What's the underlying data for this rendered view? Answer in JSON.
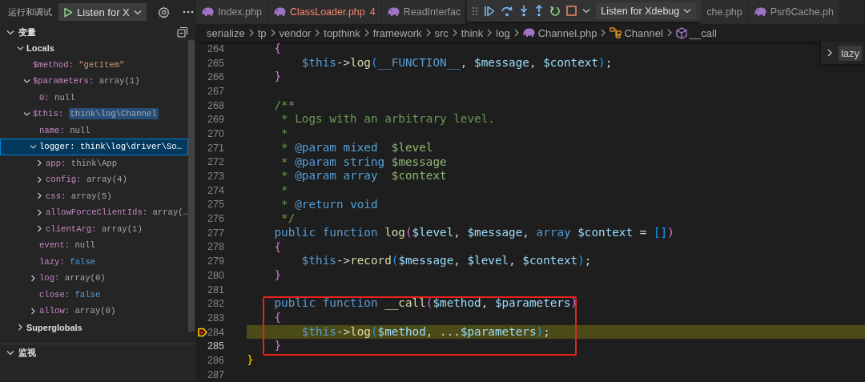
{
  "sidebar": {
    "title": "运行和调试",
    "launch_config": "Listen for X"
  },
  "variables_section": {
    "title": "变量",
    "expanded": true,
    "items": [
      {
        "name": "Locals",
        "kind": "scope",
        "expanded": true,
        "selected": false,
        "children": [
          {
            "name": "$method:",
            "value": "\"getItem\"",
            "kind": "string",
            "selected": false,
            "value_highlighted": false
          },
          {
            "name": "$parameters:",
            "value": "array(1)",
            "kind": "type",
            "expanded": true,
            "selected": false,
            "value_highlighted": false,
            "children": [
              {
                "name": "0:",
                "value": "null",
                "kind": "null",
                "selected": false,
                "value_highlighted": false
              }
            ]
          },
          {
            "name": "$this:",
            "value": "think\\log\\Channel",
            "kind": "type",
            "expanded": true,
            "selected": false,
            "value_highlighted": true,
            "children": [
              {
                "name": "name:",
                "value": "null",
                "kind": "null",
                "selected": false,
                "value_highlighted": false
              },
              {
                "name": "logger:",
                "value": "think\\log\\driver\\So…",
                "kind": "type",
                "expanded": true,
                "selected": true,
                "value_highlighted": false,
                "children": [
                  {
                    "name": "app:",
                    "value": "think\\App",
                    "kind": "type",
                    "expanded": false,
                    "selected": false,
                    "value_highlighted": false
                  },
                  {
                    "name": "config:",
                    "value": "array(4)",
                    "kind": "type",
                    "expanded": false,
                    "selected": false,
                    "value_highlighted": false
                  },
                  {
                    "name": "css:",
                    "value": "array(5)",
                    "kind": "type",
                    "expanded": false,
                    "selected": false,
                    "value_highlighted": false
                  },
                  {
                    "name": "allowForceClientIds:",
                    "value": "array(…",
                    "kind": "type",
                    "expanded": false,
                    "selected": false,
                    "value_highlighted": false
                  },
                  {
                    "name": "clientArg:",
                    "value": "array(1)",
                    "kind": "type",
                    "expanded": false,
                    "selected": false,
                    "value_highlighted": false
                  }
                ]
              },
              {
                "name": "event:",
                "value": "null",
                "kind": "null",
                "selected": false,
                "value_highlighted": false
              },
              {
                "name": "lazy:",
                "value": "false",
                "kind": "bool",
                "selected": false,
                "value_highlighted": false
              },
              {
                "name": "log:",
                "value": "array(0)",
                "kind": "type",
                "expanded": false,
                "selected": false,
                "value_highlighted": false
              },
              {
                "name": "close:",
                "value": "false",
                "kind": "bool",
                "selected": false,
                "value_highlighted": false
              },
              {
                "name": "allow:",
                "value": "array(0)",
                "kind": "type",
                "expanded": false,
                "selected": false,
                "value_highlighted": false
              }
            ]
          }
        ]
      },
      {
        "name": "Superglobals",
        "kind": "scope",
        "expanded": false,
        "selected": false
      }
    ]
  },
  "watch_section": {
    "title": "监视",
    "expanded": true
  },
  "tabs": [
    {
      "label": "Index.php",
      "icon_visible": true,
      "has_errors": false,
      "selected": false
    },
    {
      "label": "ClassLoader.php",
      "problems": "4",
      "icon_visible": true,
      "has_errors": true,
      "selected": false
    },
    {
      "label": "ReadInterfac",
      "icon_visible": true,
      "has_errors": false,
      "selected": false
    },
    {
      "label": "che.php",
      "icon_visible": false,
      "has_errors": false,
      "selected": false
    },
    {
      "label": "Psr6Cache.ph",
      "icon_visible": true,
      "has_errors": false,
      "selected": false
    }
  ],
  "debug_toolbar": {
    "config": "Listen for Xdebug"
  },
  "breadcrumb": [
    {
      "text": "serialize",
      "kind": "folder"
    },
    {
      "text": "tp",
      "kind": "folder"
    },
    {
      "text": "vendor",
      "kind": "folder"
    },
    {
      "text": "topthink",
      "kind": "folder"
    },
    {
      "text": "framework",
      "kind": "folder"
    },
    {
      "text": "src",
      "kind": "folder"
    },
    {
      "text": "think",
      "kind": "folder"
    },
    {
      "text": "log",
      "kind": "folder"
    },
    {
      "text": "Channel.php",
      "kind": "file"
    },
    {
      "text": "Channel",
      "kind": "class"
    },
    {
      "text": "__call",
      "kind": "method"
    }
  ],
  "hover_widget": {
    "text": "lazy"
  },
  "lines": [
    {
      "number": "264",
      "kind": "code",
      "tokens": [
        {
          "text": "    {",
          "kind": "brace-purple"
        }
      ]
    },
    {
      "number": "265",
      "kind": "code",
      "tokens": [
        {
          "text": "        $this",
          "kind": "this"
        },
        {
          "text": "->",
          "kind": "punct"
        },
        {
          "text": "log",
          "kind": "fn"
        },
        {
          "text": "(",
          "kind": "brace-blue"
        },
        {
          "text": "__FUNCTION__",
          "kind": "kw"
        },
        {
          "text": ", ",
          "kind": "punct"
        },
        {
          "text": "$message",
          "kind": "var"
        },
        {
          "text": ", ",
          "kind": "punct"
        },
        {
          "text": "$context",
          "kind": "var"
        },
        {
          "text": ")",
          "kind": "brace-blue"
        },
        {
          "text": ";",
          "kind": "punct"
        }
      ]
    },
    {
      "number": "266",
      "kind": "code",
      "tokens": [
        {
          "text": "    }",
          "kind": "brace-purple"
        }
      ]
    },
    {
      "number": "267",
      "kind": "code"
    },
    {
      "number": "268",
      "kind": "code",
      "tokens": [
        {
          "text": "    /**",
          "kind": "comment"
        }
      ]
    },
    {
      "number": "269",
      "kind": "code",
      "tokens": [
        {
          "text": "     * Logs with an arbitrary level.",
          "kind": "comment"
        }
      ]
    },
    {
      "number": "270",
      "kind": "code",
      "tokens": [
        {
          "text": "     *",
          "kind": "comment"
        }
      ]
    },
    {
      "number": "271",
      "kind": "code",
      "tokens": [
        {
          "text": "     * ",
          "kind": "comment"
        },
        {
          "text": "@param",
          "kind": "doctag"
        },
        {
          "text": " mixed  ",
          "kind": "doctype"
        },
        {
          "text": "$level",
          "kind": "docvar"
        }
      ]
    },
    {
      "number": "272",
      "kind": "code",
      "tokens": [
        {
          "text": "     * ",
          "kind": "comment"
        },
        {
          "text": "@param",
          "kind": "doctag"
        },
        {
          "text": " string ",
          "kind": "doctype"
        },
        {
          "text": "$message",
          "kind": "docvar"
        }
      ]
    },
    {
      "number": "273",
      "kind": "code",
      "tokens": [
        {
          "text": "     * ",
          "kind": "comment"
        },
        {
          "text": "@param",
          "kind": "doctag"
        },
        {
          "text": " array  ",
          "kind": "doctype"
        },
        {
          "text": "$context",
          "kind": "docvar"
        }
      ]
    },
    {
      "number": "274",
      "kind": "code",
      "tokens": [
        {
          "text": "     *",
          "kind": "comment"
        }
      ]
    },
    {
      "number": "275",
      "kind": "code",
      "tokens": [
        {
          "text": "     * ",
          "kind": "comment"
        },
        {
          "text": "@return",
          "kind": "doctag"
        },
        {
          "text": " void",
          "kind": "doctype"
        }
      ]
    },
    {
      "number": "276",
      "kind": "code",
      "tokens": [
        {
          "text": "     */",
          "kind": "comment"
        }
      ]
    },
    {
      "number": "277",
      "kind": "code",
      "tokens": [
        {
          "text": "    public function ",
          "kind": "kw"
        },
        {
          "text": "log",
          "kind": "fn"
        },
        {
          "text": "(",
          "kind": "brace-purple"
        },
        {
          "text": "$level",
          "kind": "var"
        },
        {
          "text": ", ",
          "kind": "punct"
        },
        {
          "text": "$message",
          "kind": "var"
        },
        {
          "text": ", ",
          "kind": "punct"
        },
        {
          "text": "array ",
          "kind": "kw"
        },
        {
          "text": "$context",
          "kind": "var"
        },
        {
          "text": " = ",
          "kind": "punct"
        },
        {
          "text": "[]",
          "kind": "brace-blue"
        },
        {
          "text": ")",
          "kind": "brace-purple"
        }
      ]
    },
    {
      "number": "278",
      "kind": "code",
      "tokens": [
        {
          "text": "    {",
          "kind": "brace-purple"
        }
      ]
    },
    {
      "number": "279",
      "kind": "code",
      "tokens": [
        {
          "text": "        $this",
          "kind": "this"
        },
        {
          "text": "->",
          "kind": "punct"
        },
        {
          "text": "record",
          "kind": "fn"
        },
        {
          "text": "(",
          "kind": "brace-blue"
        },
        {
          "text": "$message",
          "kind": "var"
        },
        {
          "text": ", ",
          "kind": "punct"
        },
        {
          "text": "$level",
          "kind": "var"
        },
        {
          "text": ", ",
          "kind": "punct"
        },
        {
          "text": "$context",
          "kind": "var"
        },
        {
          "text": ")",
          "kind": "brace-blue"
        },
        {
          "text": ";",
          "kind": "punct"
        }
      ]
    },
    {
      "number": "280",
      "kind": "code",
      "tokens": [
        {
          "text": "    }",
          "kind": "brace-purple"
        }
      ]
    },
    {
      "number": "281",
      "kind": "code"
    },
    {
      "kind": "annotation-frame",
      "lines": [
        {
          "number": "282",
          "kind": "code",
          "tokens": [
            {
              "text": "    public function ",
              "kind": "kw"
            },
            {
              "text": "__call",
              "kind": "fn"
            },
            {
              "text": "(",
              "kind": "brace-purple"
            },
            {
              "text": "$method",
              "kind": "var"
            },
            {
              "text": ", ",
              "kind": "punct"
            },
            {
              "text": "$parameters",
              "kind": "var"
            },
            {
              "text": ")",
              "kind": "brace-purple"
            }
          ]
        },
        {
          "number": "283",
          "kind": "code",
          "tokens": [
            {
              "text": "    {",
              "kind": "brace-purple"
            }
          ]
        },
        {
          "number": "284",
          "kind": "execution",
          "tokens": [
            {
              "text": "        $this",
              "kind": "this"
            },
            {
              "text": "->",
              "kind": "punct"
            },
            {
              "text": "log",
              "kind": "fn"
            },
            {
              "text": "(",
              "kind": "brace-blue"
            },
            {
              "text": "$method",
              "kind": "var"
            },
            {
              "text": ", ...",
              "kind": "punct"
            },
            {
              "text": "$parameters",
              "kind": "var"
            },
            {
              "text": ")",
              "kind": "brace-blue"
            },
            {
              "text": ";",
              "kind": "punct"
            }
          ]
        },
        {
          "number": "285",
          "kind": "cursor",
          "tokens": [
            {
              "text": "    }",
              "kind": "brace-purple"
            }
          ]
        }
      ]
    },
    {
      "number": "286",
      "kind": "code",
      "tokens": [
        {
          "text": "}",
          "kind": "brace-gold"
        }
      ]
    },
    {
      "number": "287",
      "kind": "code"
    }
  ]
}
